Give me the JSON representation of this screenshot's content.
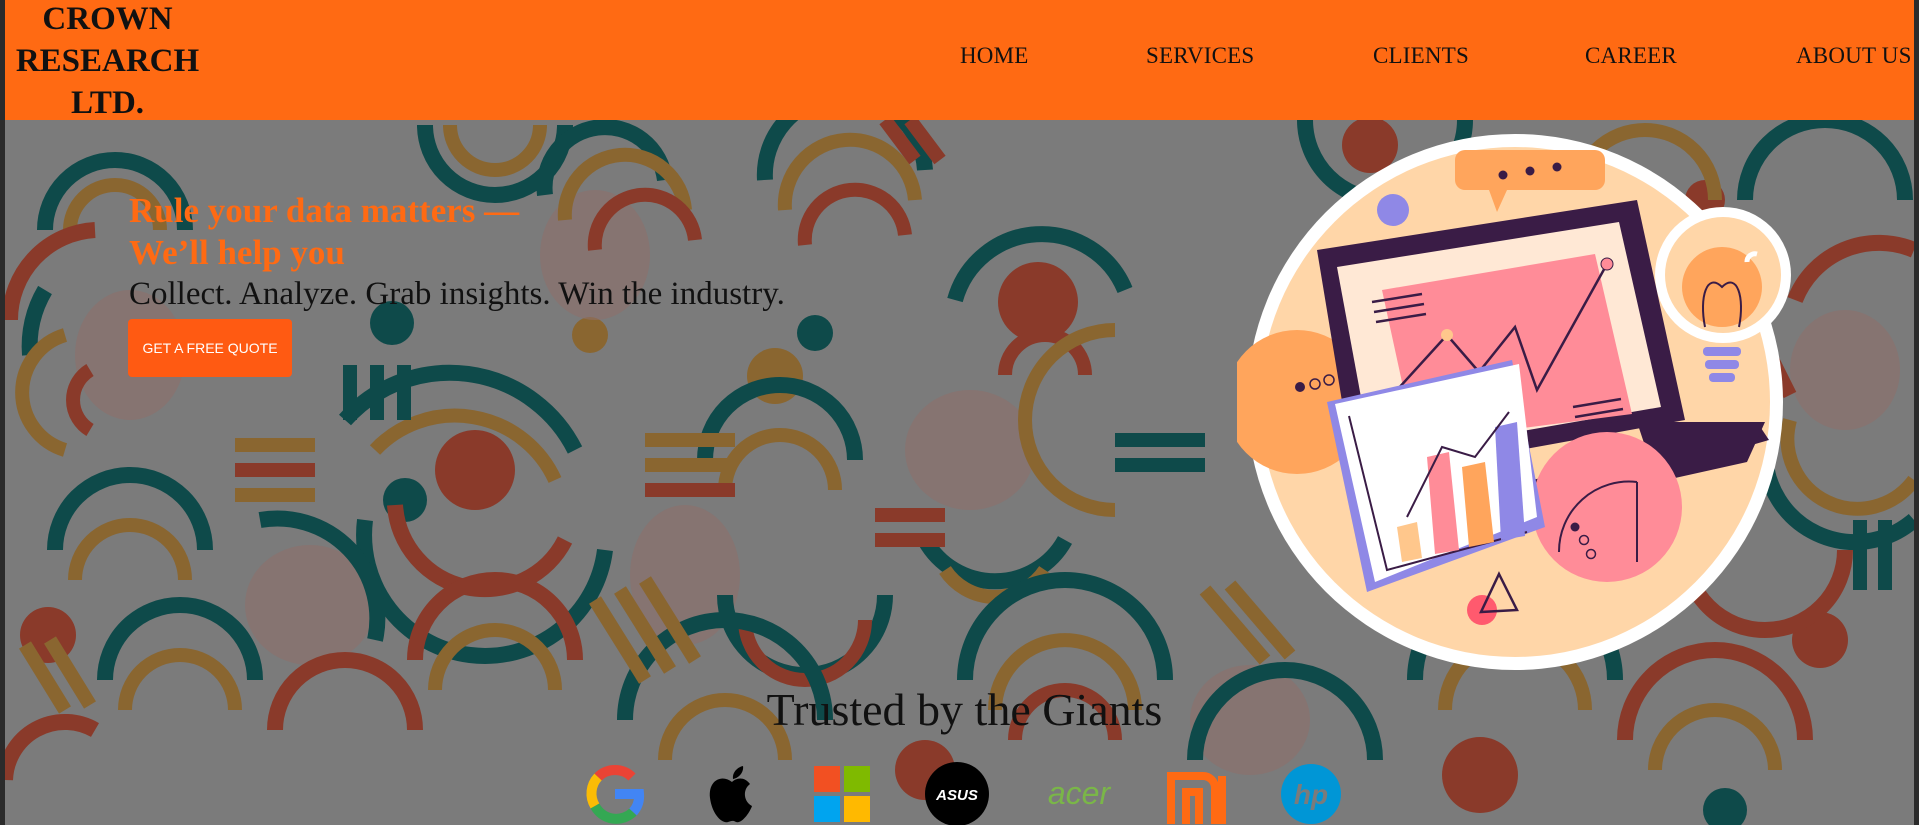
{
  "brand": {
    "line1": "CROWN",
    "line2": "RESEARCH",
    "line3": "LTD."
  },
  "nav": {
    "items": [
      "HOME",
      "SERVICES",
      "CLIENTS",
      "CAREER",
      "ABOUT US"
    ]
  },
  "hero": {
    "headline_line1": "Rule your data matters —",
    "headline_line2": "We’ll help you",
    "subtitle": "Collect. Analyze. Grab insights. Win the industry.",
    "cta_label": "GET A FREE QUOTE"
  },
  "trusted": {
    "title": "Trusted by the Giants",
    "logos": [
      {
        "name": "google-logo",
        "text": ""
      },
      {
        "name": "apple-logo",
        "text": ""
      },
      {
        "name": "microsoft-logo",
        "text": ""
      },
      {
        "name": "asus-logo",
        "text": "ASUS"
      },
      {
        "name": "acer-logo",
        "text": "acer"
      },
      {
        "name": "xiaomi-logo",
        "text": "mi"
      },
      {
        "name": "hp-logo",
        "text": "hp"
      }
    ]
  },
  "colors": {
    "accent": "#ff6a13",
    "cta": "#ff5a12",
    "pattern_red": "#8a3a2a",
    "pattern_teal": "#0e4a4a",
    "pattern_gold": "#8a6630"
  }
}
